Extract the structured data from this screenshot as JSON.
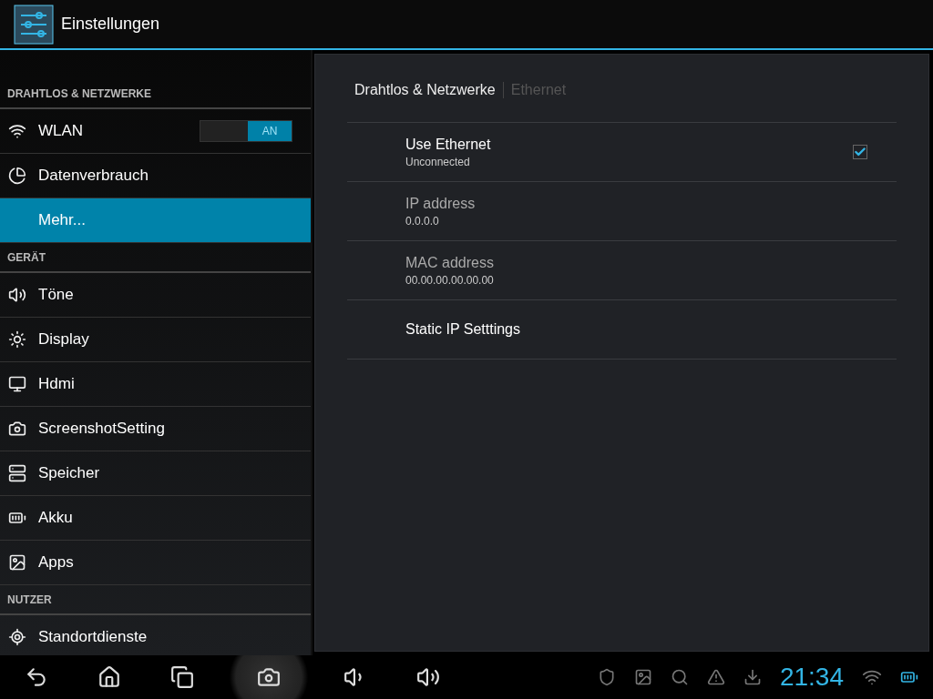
{
  "action_bar": {
    "title": "Einstellungen"
  },
  "sidebar": {
    "sections": [
      {
        "title": "DRAHTLOS & NETZWERKE",
        "items": [
          {
            "label": "WLAN",
            "selected": false,
            "toggle": {
              "on": true,
              "label": "AN"
            }
          },
          {
            "label": "Datenverbrauch",
            "selected": false
          },
          {
            "label": "Mehr...",
            "selected": true
          }
        ]
      },
      {
        "title": "GERÄT",
        "items": [
          {
            "label": "Töne",
            "selected": false
          },
          {
            "label": "Display",
            "selected": false
          },
          {
            "label": "Hdmi",
            "selected": false
          },
          {
            "label": "ScreenshotSetting",
            "selected": false
          },
          {
            "label": "Speicher",
            "selected": false
          },
          {
            "label": "Akku",
            "selected": false
          },
          {
            "label": "Apps",
            "selected": false
          }
        ]
      },
      {
        "title": "NUTZER",
        "items": [
          {
            "label": "Standortdienste",
            "selected": false
          }
        ]
      }
    ]
  },
  "detail": {
    "breadcrumb": {
      "parent": "Drahtlos & Netzwerke",
      "current": "Ethernet"
    },
    "preferences": [
      {
        "title": "Use Ethernet",
        "summary": "Unconnected",
        "disabled": false,
        "checked": true
      },
      {
        "title": "IP address",
        "summary": "0.0.0.0",
        "disabled": true
      },
      {
        "title": "MAC address",
        "summary": "00.00.00.00.00.00",
        "disabled": true
      },
      {
        "title": "Static IP Setttings",
        "disabled": false
      }
    ]
  },
  "nav_bar": {
    "clock": "21:34"
  }
}
